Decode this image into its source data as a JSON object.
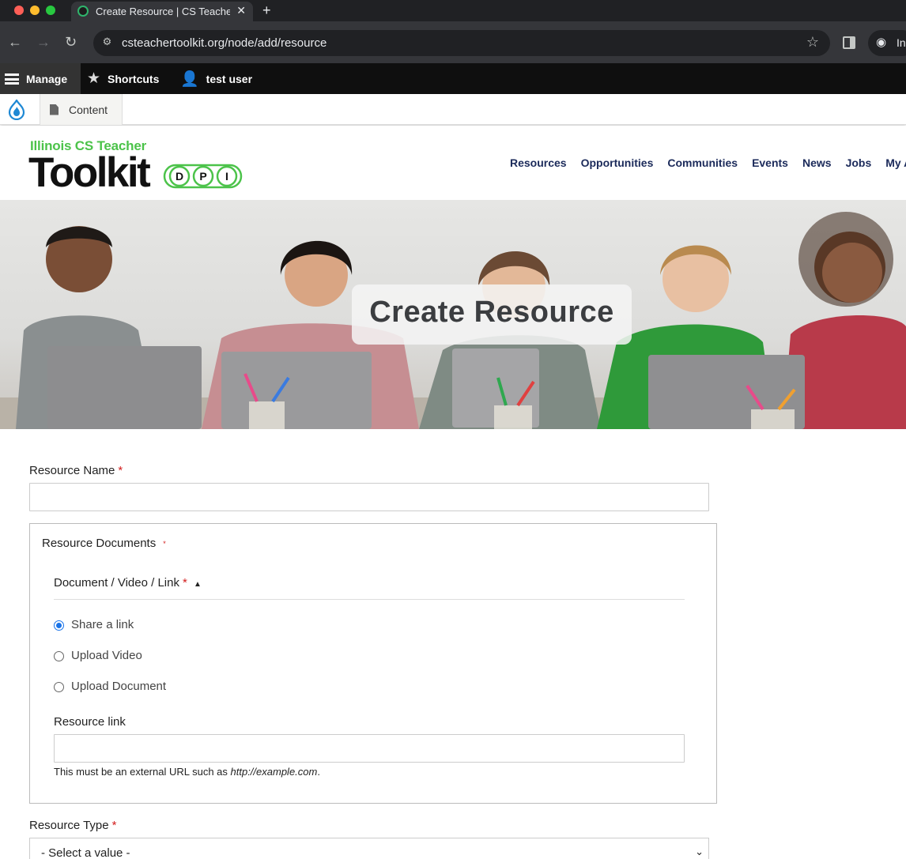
{
  "browser": {
    "tab_title": "Create Resource | CS Teacher Toolkit",
    "tab_close": "✕",
    "new_tab": "+",
    "url": "csteachertoolkit.org/node/add/resource",
    "profile_label": "In",
    "icons": [
      "back-arrow-icon",
      "forward-arrow-icon",
      "reload-icon",
      "site-settings-icon",
      "bookmark-star-icon",
      "side-panel-icon",
      "incognito-icon"
    ]
  },
  "admin_toolbar": {
    "manage_label": "Manage",
    "shortcuts_label": "Shortcuts",
    "user_label": "test user",
    "tray_content_label": "Content"
  },
  "site": {
    "logo_subtitle": "Illinois CS Teacher",
    "logo_title": "Toolkit",
    "logo_badge_letters": [
      "D",
      "P",
      "I"
    ],
    "brand_green": "#4cc34a",
    "nav_color": "#1b2a5a",
    "nav": [
      "Resources",
      "Opportunities",
      "Communities",
      "Events",
      "News",
      "Jobs",
      "My Account"
    ]
  },
  "hero": {
    "title": "Create Resource"
  },
  "form": {
    "resource_name_label": "Resource Name",
    "required_marker": "*",
    "resource_name_value": "",
    "documents_legend": "Resource Documents",
    "document_type_label": "Document / Video / Link",
    "collapse_marker": "▲",
    "document_options": [
      {
        "label": "Share a link",
        "checked": true
      },
      {
        "label": "Upload Video",
        "checked": false
      },
      {
        "label": "Upload Document",
        "checked": false
      }
    ],
    "resource_link_label": "Resource link",
    "resource_link_value": "",
    "help_prefix": "This must be an external URL such as ",
    "help_example": "http://example.com",
    "help_suffix": ".",
    "resource_type_label": "Resource Type",
    "resource_type_value": "- Select a value -",
    "accent_color": "#1a73e8"
  }
}
